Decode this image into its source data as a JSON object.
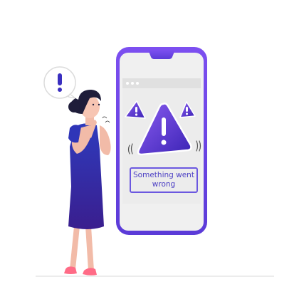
{
  "error_message": "Something went wrong",
  "colors": {
    "accent": "#6d4be6",
    "accent_dark": "#3b2bb0",
    "dress": "#2f35b8",
    "skin": "#f7c5b3",
    "hair": "#1f1d3a",
    "screen": "#f1f1f1"
  },
  "icons": [
    "exclamation-bubble-icon",
    "warning-triangle-icon",
    "browser-dots-icon"
  ]
}
